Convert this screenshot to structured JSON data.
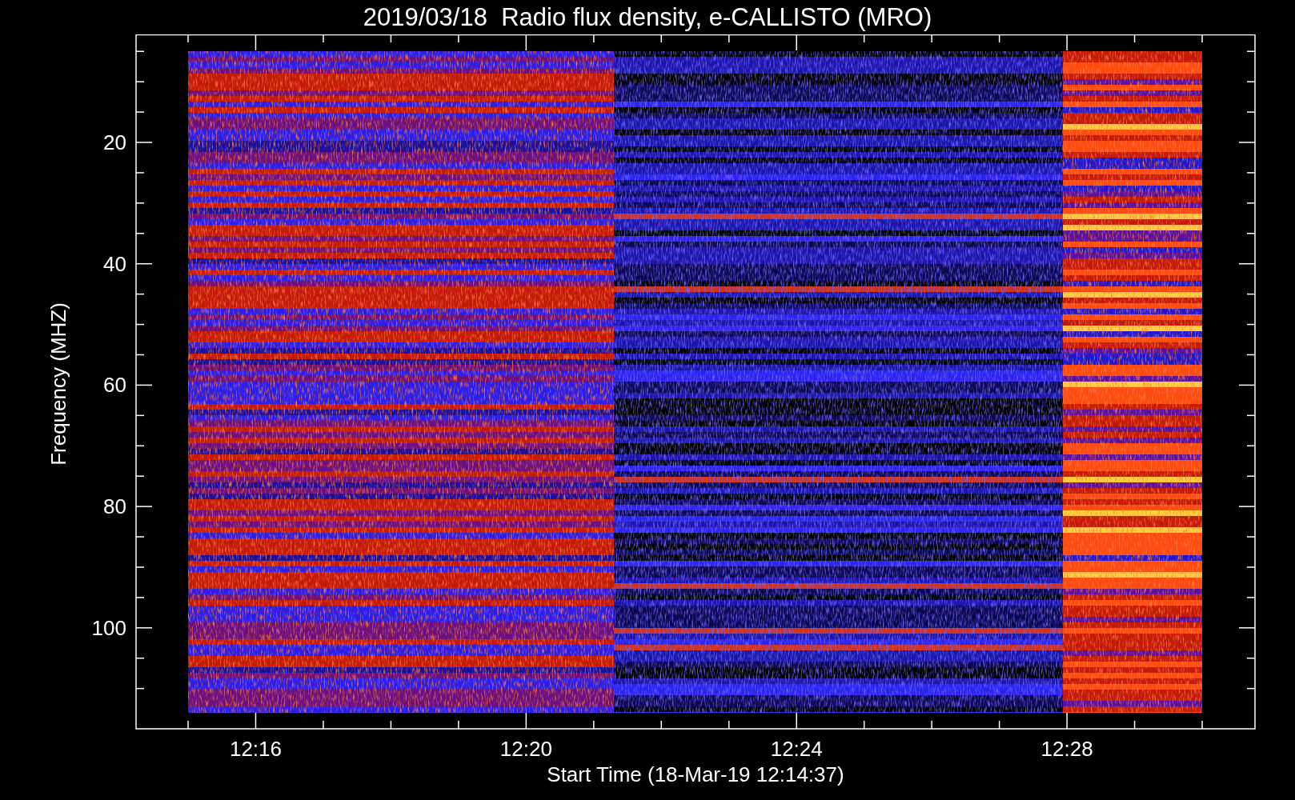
{
  "title": "2019/03/18  Radio flux density, e-CALLISTO (MRO)",
  "y_axis": {
    "label": "Frequency (MHZ)",
    "tick_labels": [
      "20",
      "40",
      "60",
      "80",
      "100"
    ]
  },
  "x_axis": {
    "label": "Start Time (18-Mar-19 12:14:37)",
    "tick_labels": [
      "12:16",
      "12:20",
      "12:24",
      "12:28"
    ]
  }
}
